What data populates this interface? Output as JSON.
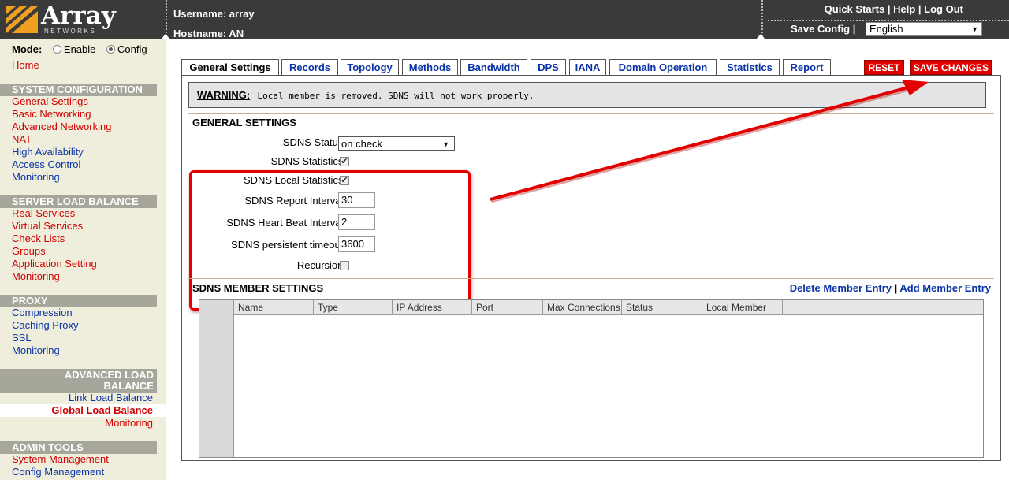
{
  "header": {
    "brand": "Array",
    "brand_sub": "NETWORKS",
    "username": "Username: array",
    "hostname": "Hostname: AN",
    "quick_starts": "Quick Starts",
    "help": "Help",
    "log_out": "Log Out",
    "save_config": "Save Config",
    "language": "English"
  },
  "sidebar": {
    "mode_label": "Mode:",
    "mode_enable": "Enable",
    "mode_config": "Config",
    "home": "Home",
    "sections": [
      {
        "title": "SYSTEM CONFIGURATION",
        "items": [
          "General Settings",
          "Basic Networking",
          "Advanced Networking",
          "NAT",
          "High Availability",
          "Access Control",
          "Monitoring"
        ]
      },
      {
        "title": "SERVER LOAD BALANCE",
        "items": [
          "Real Services",
          "Virtual Services",
          "Check Lists",
          "Groups",
          "Application Setting",
          "Monitoring"
        ]
      },
      {
        "title": "PROXY",
        "items": [
          "Compression",
          "Caching Proxy",
          "SSL",
          "Monitoring"
        ]
      },
      {
        "title": "ADVANCED LOAD BALANCE",
        "items": [
          "Link Load Balance",
          "Global Load Balance",
          "Monitoring"
        ]
      },
      {
        "title": "ADMIN TOOLS",
        "items": [
          "System Management",
          "Config Management"
        ]
      }
    ]
  },
  "tabs": [
    "General Settings",
    "Records",
    "Topology",
    "Methods",
    "Bandwidth",
    "DPS",
    "IANA",
    "Domain Operation",
    "Statistics",
    "Report"
  ],
  "buttons": {
    "reset": "RESET",
    "save_changes": "SAVE CHANGES"
  },
  "warning": {
    "label": "WARNING:",
    "message": "Local member is removed. SDNS will not work properly."
  },
  "general": {
    "title": "GENERAL SETTINGS",
    "sdns_status_label": "SDNS Status:",
    "sdns_status_value": "on check",
    "sdns_statistics_label": "SDNS Statistics:",
    "sdns_local_statistics_label": "SDNS Local Statistics:",
    "report_interval_label": "SDNS Report Interval:",
    "report_interval_value": "30",
    "heartbeat_label": "SDNS Heart Beat Interval:",
    "heartbeat_value": "2",
    "persistent_label": "SDNS persistent timeout:",
    "persistent_value": "3600",
    "recursion_label": "Recursion:",
    "sdns_statistics_checked": true,
    "sdns_local_statistics_checked": true,
    "recursion_checked": false
  },
  "members": {
    "title": "SDNS MEMBER SETTINGS",
    "delete_link": "Delete Member Entry",
    "add_link": "Add Member Entry",
    "columns": [
      "Name",
      "Type",
      "IP Address",
      "Port",
      "Max Connections",
      "Status",
      "Local Member"
    ]
  },
  "colors": {
    "header_bg": "#3a3a3a",
    "sidebar_bg": "#efeedc",
    "link_red": "#d00000",
    "link_blue": "#0a33a6",
    "annotation_red": "#e20000"
  }
}
